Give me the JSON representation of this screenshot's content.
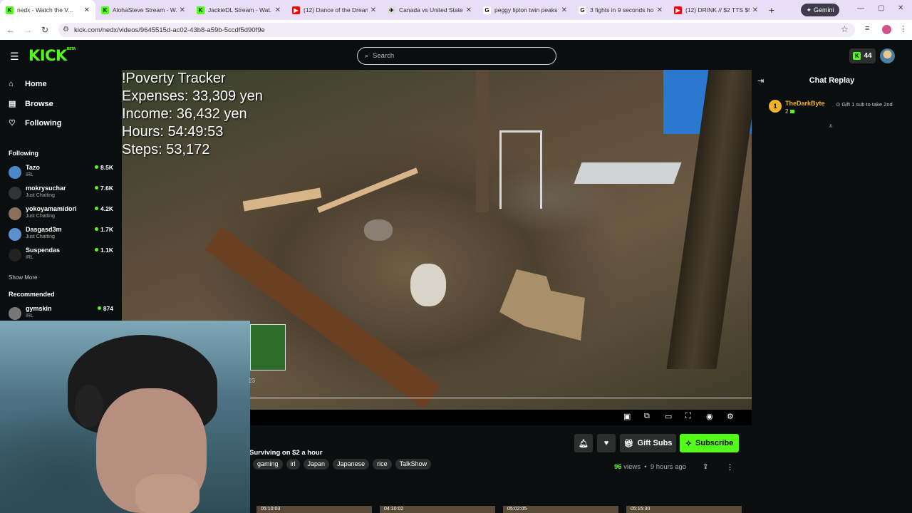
{
  "browser": {
    "tabs": [
      {
        "title": "nedx - Watch the V...",
        "fav_color": "#53fc18",
        "fav_glyph": "K",
        "active": true
      },
      {
        "title": "AlohaSteve Stream - W...",
        "fav_color": "#53fc18",
        "fav_glyph": "K"
      },
      {
        "title": "JackieDL Stream - Wat...",
        "fav_color": "#53fc18",
        "fav_glyph": "K"
      },
      {
        "title": "(12) Dance of the Dream...",
        "fav_color": "#ff0000",
        "fav_glyph": "▶"
      },
      {
        "title": "Canada vs United States",
        "fav_color": "#dddddd",
        "fav_glyph": "✈"
      },
      {
        "title": "peggy lipton twin peaks",
        "fav_color": "#ffffff",
        "fav_glyph": "G"
      },
      {
        "title": "3 fights in 9 seconds ho...",
        "fav_color": "#ffffff",
        "fav_glyph": "G"
      },
      {
        "title": "(12) DRINK // $2 TTS $5",
        "fav_color": "#ff0000",
        "fav_glyph": "▶"
      }
    ],
    "gemini_label": "Gemini",
    "url": "kick.com/nedx/videos/9645515d-ac02-43b8-a59b-5ccdf5d90f9e"
  },
  "header": {
    "logo": "KICK",
    "logo_badge": "BETA",
    "search_placeholder": "Search",
    "kicks_count": "44"
  },
  "sidebar": {
    "nav": [
      {
        "label": "Home",
        "icon": "home-icon",
        "glyph": "⌂"
      },
      {
        "label": "Browse",
        "icon": "browse-icon",
        "glyph": "▤"
      },
      {
        "label": "Following",
        "icon": "heart-icon",
        "glyph": "♡"
      }
    ],
    "following_heading": "Following",
    "following": [
      {
        "name": "Tazo",
        "category": "IRL",
        "viewers": "8.5K",
        "color": "#4a88c8"
      },
      {
        "name": "mokrysuchar",
        "category": "Just Chatting",
        "viewers": "7.6K",
        "color": "#333333"
      },
      {
        "name": "yokoyamamidori",
        "category": "Just Chatting",
        "viewers": "4.2K",
        "color": "#8a6f5a"
      },
      {
        "name": "Dasgasd3m",
        "category": "Just Chatting",
        "viewers": "1.7K",
        "color": "#5b8fd0"
      },
      {
        "name": "Suspendas",
        "category": "IRL",
        "viewers": "1.1K",
        "color": "#222222"
      }
    ],
    "show_more": "Show More",
    "recommended_heading": "Recommended",
    "recommended": [
      {
        "name": "gymskin",
        "category": "IRL",
        "viewers": "874",
        "color": "#777777"
      }
    ]
  },
  "overlay": {
    "lines": [
      "!Poverty Tracker",
      "Expenses: 33,309 yen",
      "Income: 36,432 yen",
      "Hours: 54:49:53",
      "Steps: 53,172"
    ]
  },
  "player": {
    "progress": 0.0
  },
  "chat": {
    "title": "Chat Replay",
    "gifter": {
      "rank": "1",
      "name": "TheDarkByte",
      "count": "2",
      "gift_text": "Gift 1 sub to take 2nd"
    }
  },
  "video_info": {
    "title": "Surviving on $2 a hour",
    "tags": [
      "gaming",
      "irl",
      "Japan",
      "Japanese",
      "rice",
      "TalkShow"
    ],
    "views_count": "96",
    "views_label": "views",
    "age": "9 hours ago",
    "gift_subs_label": "Gift Subs",
    "subscribe_label": "Subscribe"
  },
  "mini_text": "23",
  "related_thumbs": [
    "05:10:03",
    "04:10:02",
    "05:02:05",
    "05:15:30"
  ]
}
